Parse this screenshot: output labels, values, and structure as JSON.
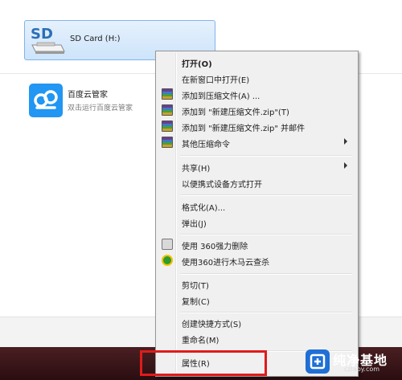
{
  "drive": {
    "label": "SD Card (H:)",
    "icon": "sd-card-icon",
    "icon_text": "SD"
  },
  "app": {
    "name": "百度云管家",
    "subtitle": "双击运行百度云管家",
    "icon": "baidu-cloud-icon"
  },
  "menu": {
    "open": "打开(O)",
    "open_new_window": "在新窗口中打开(E)",
    "add_to_archive": "添加到压缩文件(A) ...",
    "add_to_zip": "添加到 \"新建压缩文件.zip\"(T)",
    "add_to_zip_email": "添加到 \"新建压缩文件.zip\" 并邮件",
    "other_compress": "其他压缩命令",
    "share": "共享(H)",
    "open_as_portable": "以便携式设备方式打开",
    "format": "格式化(A)...",
    "eject": "弹出(J)",
    "force_delete_360": "使用 360强力删除",
    "scan_360": "使用360进行木马云查杀",
    "cut": "剪切(T)",
    "copy": "复制(C)",
    "create_shortcut": "创建快捷方式(S)",
    "rename": "重命名(M)",
    "properties": "属性(R)"
  },
  "watermark": {
    "title": "纯净基地",
    "url": "czlaby.com"
  },
  "colors": {
    "highlight": "#e01b1b",
    "selection": "#cde4fb",
    "menu_bg": "#f0f0f0"
  }
}
